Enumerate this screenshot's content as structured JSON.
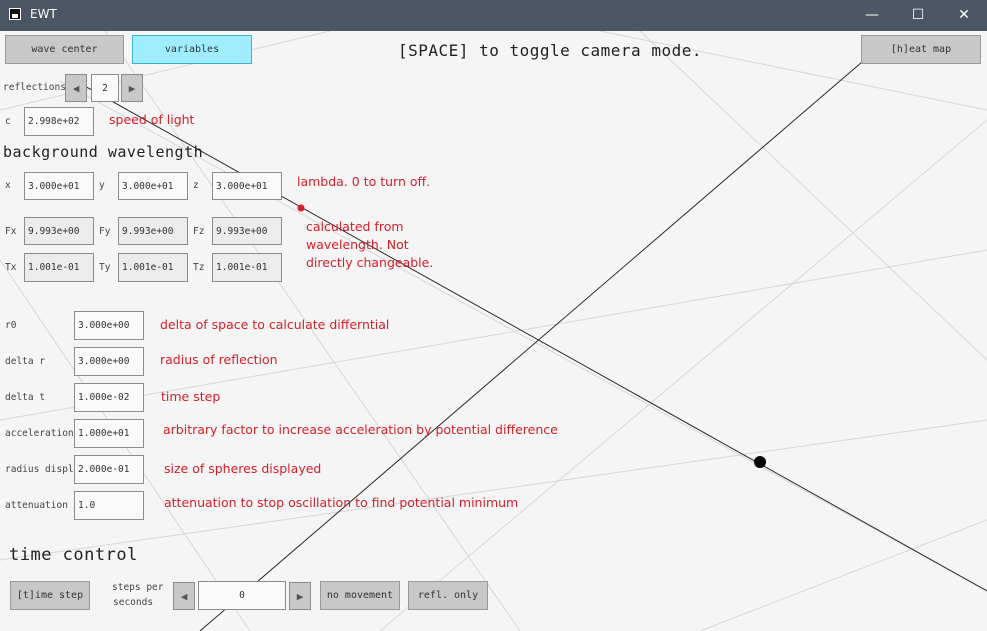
{
  "window": {
    "title": "EWT",
    "minimize": "—",
    "maximize": "☐",
    "close": "✕"
  },
  "top": {
    "wave_center": "wave center",
    "variables": "variables",
    "hint": "[SPACE] to toggle camera mode.",
    "heat_map": "[h]eat map"
  },
  "reflections": {
    "label": "reflections",
    "value": "2",
    "left": "◀",
    "right": "▶"
  },
  "c": {
    "label": "c",
    "value": "2.998e+02",
    "note": "speed of light"
  },
  "background": {
    "heading": "background wavelength",
    "lambda": [
      {
        "label": "x",
        "value": "3.000e+01"
      },
      {
        "label": "y",
        "value": "3.000e+01"
      },
      {
        "label": "z",
        "value": "3.000e+01"
      }
    ],
    "lambda_note": "lambda. 0 to turn off.",
    "f": [
      {
        "label": "Fx",
        "value": "9.993e+00"
      },
      {
        "label": "Fy",
        "value": "9.993e+00"
      },
      {
        "label": "Fz",
        "value": "9.993e+00"
      }
    ],
    "t": [
      {
        "label": "Tx",
        "value": "1.001e-01"
      },
      {
        "label": "Ty",
        "value": "1.001e-01"
      },
      {
        "label": "Tz",
        "value": "1.001e-01"
      }
    ],
    "calc_note": [
      "calculated from",
      "wavelength. Not",
      "directly changeable."
    ]
  },
  "params": [
    {
      "label": "r0",
      "value": "3.000e+00",
      "note": "delta of space to calculate differntial"
    },
    {
      "label": "delta r",
      "value": "3.000e+00",
      "note": "radius of reflection"
    },
    {
      "label": "delta t",
      "value": "1.000e-02",
      "note": "time step"
    },
    {
      "label": "acceleration",
      "value": "1.000e+01",
      "note": "arbitrary factor to increase acceleration by potential difference"
    },
    {
      "label": "radius displ",
      "value": "2.000e-01",
      "note": "size of spheres displayed"
    },
    {
      "label": "attenuation",
      "value": "1.0",
      "note": "attenuation to stop oscillation to find potential minimum"
    }
  ],
  "time_control": {
    "heading": "time control",
    "time_step": "[t]ime step",
    "steps_label_1": "steps per",
    "steps_label_2": "seconds",
    "steps_value": "0",
    "left": "◀",
    "right": "▶",
    "no_movement": "no movement",
    "refl_only": "refl. only"
  },
  "colors": {
    "titlebar": "#4c5563",
    "active_button": "#9feeff",
    "note_red": "#d3202a",
    "background": "#f5f5f5"
  }
}
